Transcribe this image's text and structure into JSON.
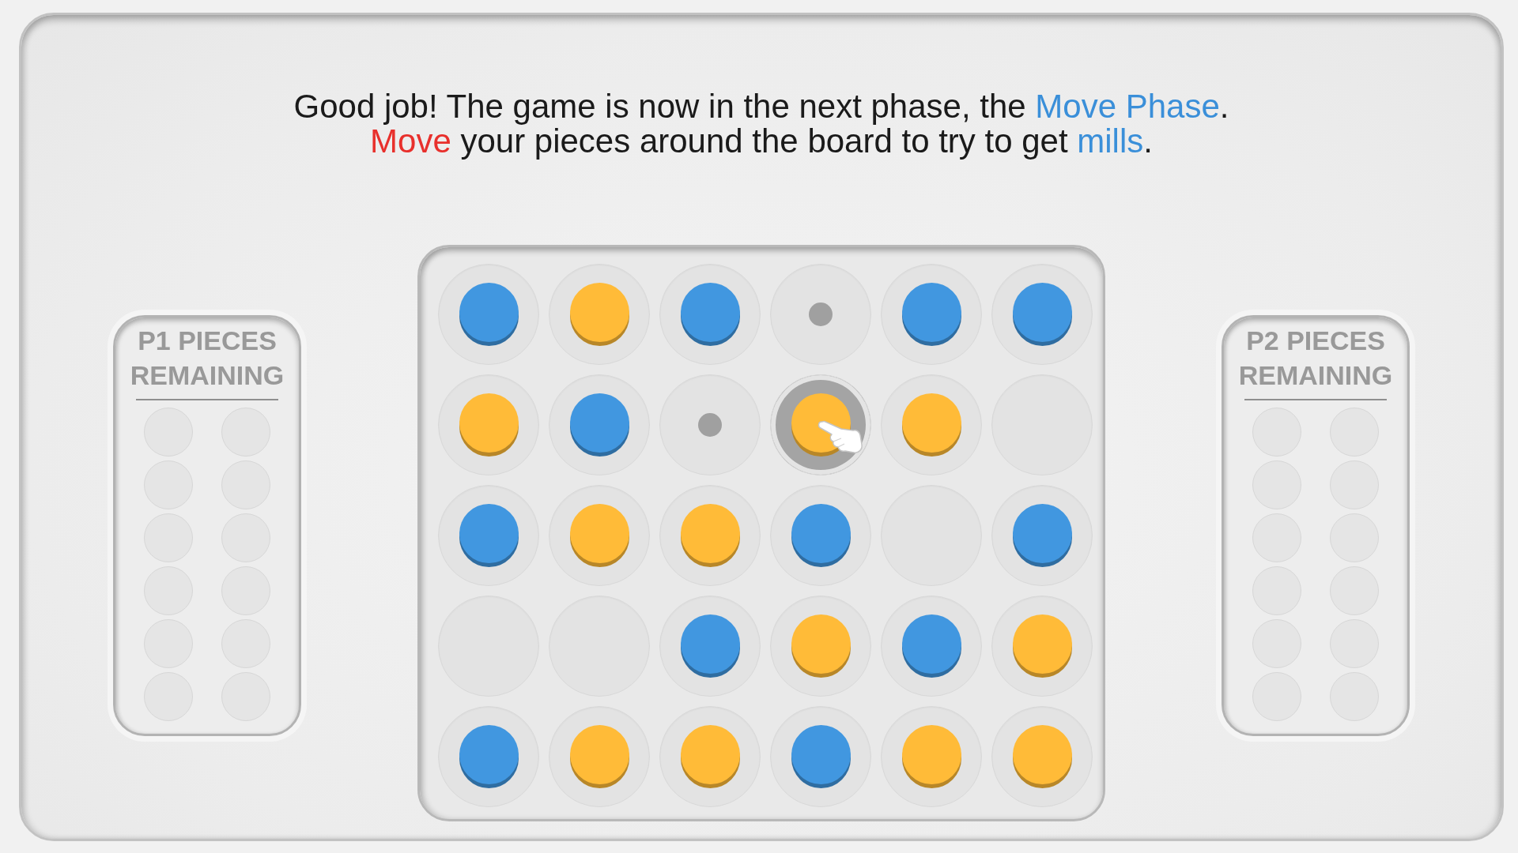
{
  "instructions": {
    "lines": [
      {
        "segments": [
          {
            "text": "Good job! The game is now in the next phase, the ",
            "color": "#1a1a1a"
          },
          {
            "text": "Move Phase",
            "color": "#3a8fd9"
          },
          {
            "text": ".",
            "color": "#1a1a1a"
          }
        ]
      },
      {
        "segments": [
          {
            "text": "Move",
            "color": "#e8302c"
          },
          {
            "text": " your pieces around the board to try to get ",
            "color": "#1a1a1a"
          },
          {
            "text": "mills",
            "color": "#3a8fd9"
          },
          {
            "text": ".",
            "color": "#1a1a1a"
          }
        ]
      }
    ]
  },
  "panels": [
    {
      "title": "P1 PIECES REMAINING",
      "slots": [
        {
          "filled": false
        },
        {
          "filled": false
        },
        {
          "filled": false
        },
        {
          "filled": false
        },
        {
          "filled": false
        },
        {
          "filled": false
        },
        {
          "filled": false
        },
        {
          "filled": false
        },
        {
          "filled": false
        },
        {
          "filled": false
        },
        {
          "filled": false
        },
        {
          "filled": false
        }
      ]
    },
    {
      "title": "P2 PIECES REMAINING",
      "slots": [
        {
          "filled": false
        },
        {
          "filled": false
        },
        {
          "filled": false
        },
        {
          "filled": false
        },
        {
          "filled": false
        },
        {
          "filled": false
        },
        {
          "filled": false
        },
        {
          "filled": false
        },
        {
          "filled": false
        },
        {
          "filled": false
        },
        {
          "filled": false
        },
        {
          "filled": false
        }
      ]
    }
  ],
  "board": {
    "rows": [
      {
        "cells": [
          {
            "kind": "piece",
            "color": "#4197e0",
            "selected": false
          },
          {
            "kind": "piece",
            "color": "#ffbb38",
            "selected": false
          },
          {
            "kind": "piece",
            "color": "#4197e0",
            "selected": false
          },
          {
            "kind": "target",
            "selected": false
          },
          {
            "kind": "piece",
            "color": "#4197e0",
            "selected": false
          },
          {
            "kind": "piece",
            "color": "#4197e0",
            "selected": false
          }
        ]
      },
      {
        "cells": [
          {
            "kind": "piece",
            "color": "#ffbb38",
            "selected": false
          },
          {
            "kind": "piece",
            "color": "#4197e0",
            "selected": false
          },
          {
            "kind": "target",
            "selected": false
          },
          {
            "kind": "piece",
            "color": "#ffbb38",
            "selected": true
          },
          {
            "kind": "piece",
            "color": "#ffbb38",
            "selected": false
          },
          {
            "kind": "empty",
            "selected": false
          }
        ]
      },
      {
        "cells": [
          {
            "kind": "piece",
            "color": "#4197e0",
            "selected": false
          },
          {
            "kind": "piece",
            "color": "#ffbb38",
            "selected": false
          },
          {
            "kind": "piece",
            "color": "#ffbb38",
            "selected": false
          },
          {
            "kind": "piece",
            "color": "#4197e0",
            "selected": false
          },
          {
            "kind": "empty",
            "selected": false
          },
          {
            "kind": "piece",
            "color": "#4197e0",
            "selected": false
          }
        ]
      },
      {
        "cells": [
          {
            "kind": "empty",
            "selected": false
          },
          {
            "kind": "empty",
            "selected": false
          },
          {
            "kind": "piece",
            "color": "#4197e0",
            "selected": false
          },
          {
            "kind": "piece",
            "color": "#ffbb38",
            "selected": false
          },
          {
            "kind": "piece",
            "color": "#4197e0",
            "selected": false
          },
          {
            "kind": "piece",
            "color": "#ffbb38",
            "selected": false
          }
        ]
      },
      {
        "cells": [
          {
            "kind": "piece",
            "color": "#4197e0",
            "selected": false
          },
          {
            "kind": "piece",
            "color": "#ffbb38",
            "selected": false
          },
          {
            "kind": "piece",
            "color": "#ffbb38",
            "selected": false
          },
          {
            "kind": "piece",
            "color": "#4197e0",
            "selected": false
          },
          {
            "kind": "piece",
            "color": "#ffbb38",
            "selected": false
          },
          {
            "kind": "piece",
            "color": "#ffbb38",
            "selected": false
          }
        ]
      }
    ]
  }
}
